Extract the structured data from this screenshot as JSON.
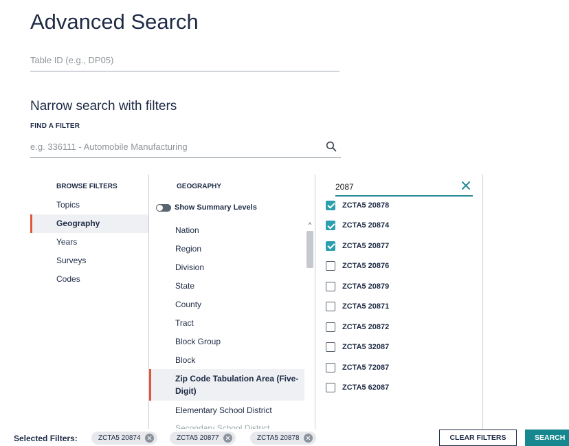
{
  "page": {
    "title": "Advanced Search"
  },
  "table_id": {
    "placeholder": "Table ID (e.g., DP05)",
    "value": ""
  },
  "filters": {
    "title": "Narrow search with filters",
    "find_label": "FIND A FILTER",
    "search_placeholder": "e.g. 336111 - Automobile Manufacturing"
  },
  "browse": {
    "heading": "BROWSE FILTERS",
    "items": [
      {
        "label": "Topics"
      },
      {
        "label": "Geography"
      },
      {
        "label": "Years"
      },
      {
        "label": "Surveys"
      },
      {
        "label": "Codes"
      }
    ],
    "active": "Geography"
  },
  "geography": {
    "heading": "GEOGRAPHY",
    "toggle_label": "Show Summary Levels",
    "items": [
      {
        "label": "Nation"
      },
      {
        "label": "Region"
      },
      {
        "label": "Division"
      },
      {
        "label": "State"
      },
      {
        "label": "County"
      },
      {
        "label": "Tract"
      },
      {
        "label": "Block Group"
      },
      {
        "label": "Block"
      },
      {
        "label": "Zip Code Tabulation Area (Five-Digit)"
      },
      {
        "label": "Elementary School District"
      },
      {
        "label": "Secondary School District"
      }
    ],
    "active": "Zip Code Tabulation Area (Five-Digit)"
  },
  "results": {
    "search_value": "2087",
    "items": [
      {
        "label": "ZCTA5 20878",
        "checked": true
      },
      {
        "label": "ZCTA5 20874",
        "checked": true
      },
      {
        "label": "ZCTA5 20877",
        "checked": true
      },
      {
        "label": "ZCTA5 20876",
        "checked": false
      },
      {
        "label": "ZCTA5 20879",
        "checked": false
      },
      {
        "label": "ZCTA5 20871",
        "checked": false
      },
      {
        "label": "ZCTA5 20872",
        "checked": false
      },
      {
        "label": "ZCTA5 32087",
        "checked": false
      },
      {
        "label": "ZCTA5 72087",
        "checked": false
      },
      {
        "label": "ZCTA5 62087",
        "checked": false
      }
    ]
  },
  "bottom": {
    "selected_label": "Selected Filters:",
    "chips": [
      {
        "label": "ZCTA5 20874"
      },
      {
        "label": "ZCTA5 20877"
      },
      {
        "label": "ZCTA5 20878"
      }
    ],
    "clear_label": "CLEAR FILTERS",
    "search_label": "SEARCH"
  },
  "colors": {
    "accent_active": "#e0573a",
    "checkbox_checked": "#2b9fae",
    "search_button": "#16868f",
    "title_text": "#1d2a44"
  }
}
